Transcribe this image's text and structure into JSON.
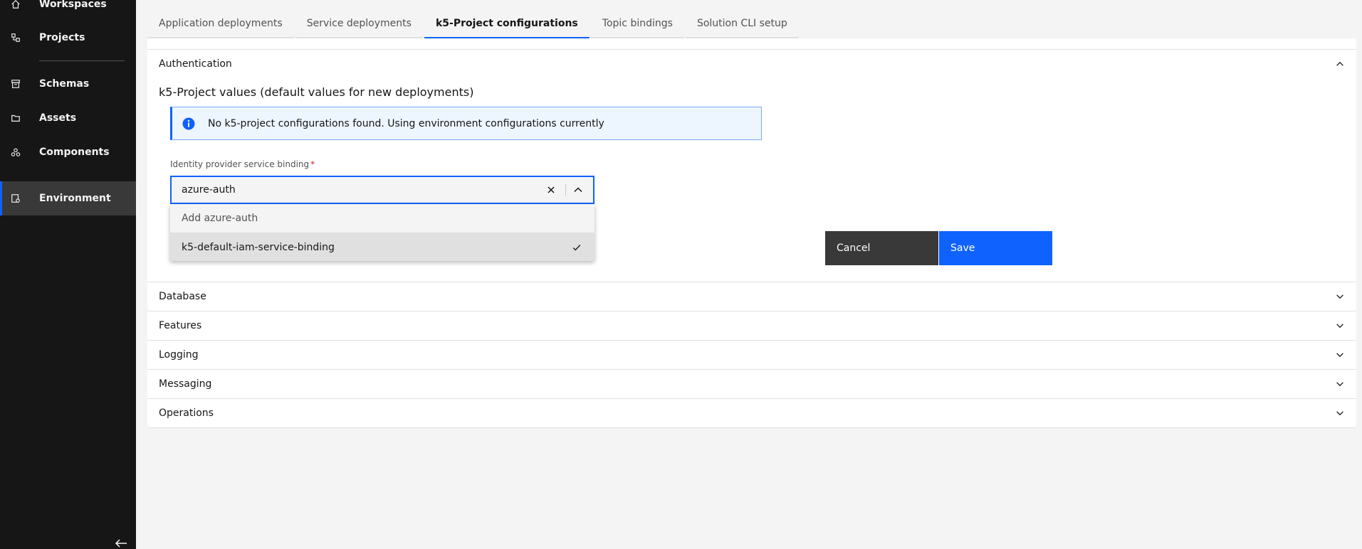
{
  "sidebar": {
    "items": [
      {
        "label": "Workspaces",
        "icon": "home-icon"
      },
      {
        "label": "Projects",
        "icon": "project-icon"
      },
      {
        "label": "Schemas",
        "icon": "schema-icon"
      },
      {
        "label": "Assets",
        "icon": "folder-icon"
      },
      {
        "label": "Components",
        "icon": "components-icon"
      },
      {
        "label": "Environment",
        "icon": "environment-icon",
        "active": true
      }
    ]
  },
  "tabs": [
    {
      "label": "Application deployments"
    },
    {
      "label": "Service deployments"
    },
    {
      "label": "k5-Project configurations",
      "active": true
    },
    {
      "label": "Topic bindings"
    },
    {
      "label": "Solution CLI setup"
    }
  ],
  "accordion": {
    "authentication": {
      "title": "Authentication",
      "section_title": "k5-Project values (default values for new deployments)",
      "notification": "No k5-project configurations found. Using environment configurations currently",
      "field": {
        "label": "Identity provider service binding",
        "required_marker": "*",
        "value": "azure-auth",
        "options": {
          "add": "Add azure-auth",
          "existing": "k5-default-iam-service-binding"
        }
      },
      "buttons": {
        "cancel": "Cancel",
        "save": "Save"
      }
    },
    "sections": [
      {
        "title": "Database"
      },
      {
        "title": "Features"
      },
      {
        "title": "Logging"
      },
      {
        "title": "Messaging"
      },
      {
        "title": "Operations"
      }
    ]
  },
  "colors": {
    "sidebar_bg": "#161616",
    "active_nav_bg": "#393939",
    "accent": "#0f62fe",
    "info_bg": "#edf5ff",
    "save_button": "#0f62fe",
    "cancel_button": "#393939"
  }
}
